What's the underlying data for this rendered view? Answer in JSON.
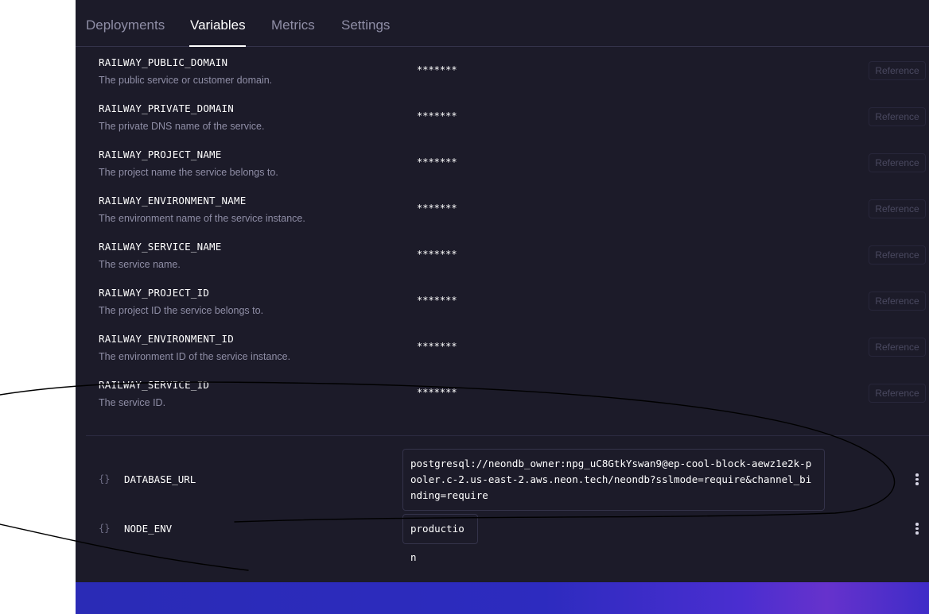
{
  "tabs": [
    {
      "label": "Deployments",
      "active": false
    },
    {
      "label": "Variables",
      "active": true
    },
    {
      "label": "Metrics",
      "active": false
    },
    {
      "label": "Settings",
      "active": false
    }
  ],
  "railway_vars": [
    {
      "name": "RAILWAY_PUBLIC_DOMAIN",
      "desc": "The public service or customer domain.",
      "value": "*******",
      "ref": "Reference"
    },
    {
      "name": "RAILWAY_PRIVATE_DOMAIN",
      "desc": "The private DNS name of the service.",
      "value": "*******",
      "ref": "Reference"
    },
    {
      "name": "RAILWAY_PROJECT_NAME",
      "desc": "The project name the service belongs to.",
      "value": "*******",
      "ref": "Reference"
    },
    {
      "name": "RAILWAY_ENVIRONMENT_NAME",
      "desc": "The environment name of the service instance.",
      "value": "*******",
      "ref": "Reference"
    },
    {
      "name": "RAILWAY_SERVICE_NAME",
      "desc": "The service name.",
      "value": "*******",
      "ref": "Reference"
    },
    {
      "name": "RAILWAY_PROJECT_ID",
      "desc": "The project ID the service belongs to.",
      "value": "*******",
      "ref": "Reference"
    },
    {
      "name": "RAILWAY_ENVIRONMENT_ID",
      "desc": "The environment ID of the service instance.",
      "value": "*******",
      "ref": "Reference"
    },
    {
      "name": "RAILWAY_SERVICE_ID",
      "desc": "The service ID.",
      "value": "*******",
      "ref": "Reference"
    }
  ],
  "user_vars": [
    {
      "icon": "{}",
      "name": "DATABASE_URL",
      "value": "postgresql://neondb_owner:npg_uC8GtkYswan9@ep-cool-block-aewz1e2k-pooler.c-2.us-east-2.aws.neon.tech/neondb?sslmode=require&channel_binding=require"
    },
    {
      "icon": "{}",
      "name": "NODE_ENV",
      "value": "production"
    }
  ],
  "colors": {
    "panel_bg": "#1c1b29",
    "text_primary": "#ffffff",
    "text_muted": "#8f8ea6",
    "banner_start": "#2a2bb6",
    "banner_accent": "#6632cc"
  }
}
